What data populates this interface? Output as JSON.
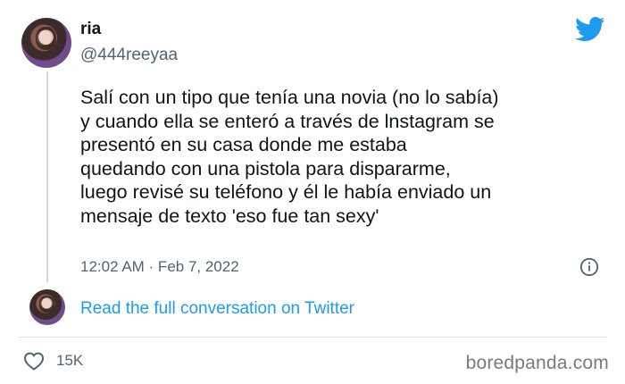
{
  "tweet": {
    "author_name": "ria",
    "author_handle": "@444reeyaa",
    "text": "Salí con un tipo que tenía una novia (no lo sabía)\ny cuando ella se enteró a través de lnstagram se\npresentó en su casa donde me estaba\nquedando con una pistola para dispararme,\nluego revisé su teléfono y él le había enviado un\nmensaje de texto 'eso fue tan sexy'",
    "timestamp": "12:02 AM · Feb 7, 2022",
    "read_full_label": "Read the full conversation on Twitter",
    "like_count": "15K"
  },
  "icons": {
    "logo": "twitter-bird-icon",
    "info": "info-icon",
    "like": "heart-icon"
  },
  "colors": {
    "brand": "#1d9bf0",
    "text": "#0f1419",
    "secondary_text": "#536471"
  },
  "watermark": "boredpanda.com"
}
